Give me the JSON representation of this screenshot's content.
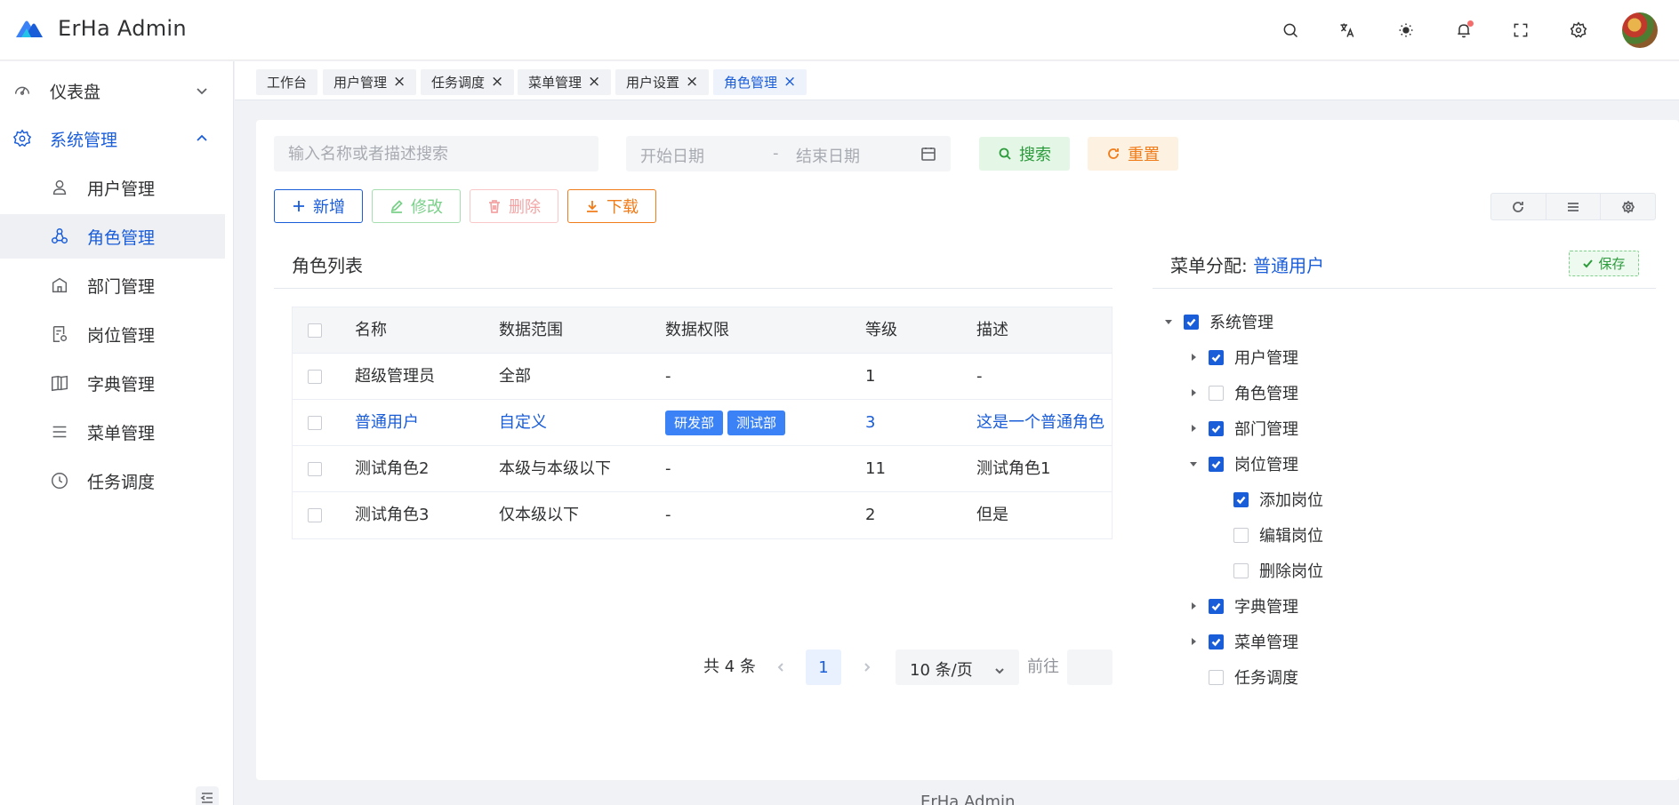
{
  "header": {
    "app_title": "ErHa Admin",
    "icons": [
      "search-icon",
      "translate-icon",
      "theme-sun-icon",
      "bell-icon",
      "fullscreen-icon",
      "settings-icon"
    ],
    "brand_color": "#1a5dd9"
  },
  "sidebar": {
    "items": [
      {
        "label": "仪表盘",
        "icon": "dashboard-icon",
        "arrow": "chevron-down"
      },
      {
        "label": "系统管理",
        "icon": "gear-icon",
        "arrow": "chevron-up",
        "state": "expanded"
      },
      {
        "label": "用户管理",
        "icon": "user-icon"
      },
      {
        "label": "角色管理",
        "icon": "role-icon",
        "state": "active"
      },
      {
        "label": "部门管理",
        "icon": "department-icon"
      },
      {
        "label": "岗位管理",
        "icon": "post-icon"
      },
      {
        "label": "字典管理",
        "icon": "dictionary-icon"
      },
      {
        "label": "菜单管理",
        "icon": "menu-icon"
      },
      {
        "label": "任务调度",
        "icon": "clock-icon"
      }
    ]
  },
  "tabs": [
    {
      "label": "工作台",
      "closable": false
    },
    {
      "label": "用户管理",
      "closable": true
    },
    {
      "label": "任务调度",
      "closable": true
    },
    {
      "label": "菜单管理",
      "closable": true
    },
    {
      "label": "用户设置",
      "closable": true
    },
    {
      "label": "角色管理",
      "closable": true,
      "active": true
    }
  ],
  "filters": {
    "search_placeholder": "输入名称或者描述搜索",
    "date_start_placeholder": "开始日期",
    "date_separator": "-",
    "date_end_placeholder": "结束日期",
    "search_label": "搜索",
    "reset_label": "重置"
  },
  "toolbar": {
    "add_label": "新增",
    "edit_label": "修改",
    "delete_label": "删除",
    "download_label": "下载"
  },
  "role_list": {
    "title": "角色列表",
    "columns": [
      "名称",
      "数据范围",
      "数据权限",
      "等级",
      "描述"
    ],
    "rows": [
      {
        "name": "超级管理员",
        "scope": "全部",
        "permission": "-",
        "tags": [],
        "level": "1",
        "desc": "-"
      },
      {
        "name": "普通用户",
        "scope": "自定义",
        "permission": "",
        "tags": [
          "研发部",
          "测试部"
        ],
        "level": "3",
        "desc": "这是一个普通角色",
        "selected": true
      },
      {
        "name": "测试角色2",
        "scope": "本级与本级以下",
        "permission": "-",
        "tags": [],
        "level": "11",
        "desc": "测试角色1"
      },
      {
        "name": "测试角色3",
        "scope": "仅本级以下",
        "permission": "-",
        "tags": [],
        "level": "2",
        "desc": "但是"
      }
    ]
  },
  "pagination": {
    "total_text": "共 4 条",
    "current_page": "1",
    "page_size": "10 条/页",
    "goto_label": "前往"
  },
  "menu_assign": {
    "title_prefix": "菜单分配:",
    "role_name": "普通用户",
    "save_label": "保存",
    "tree": [
      {
        "label": "系统管理",
        "level": 0,
        "arrow": "down",
        "checked": true
      },
      {
        "label": "用户管理",
        "level": 1,
        "arrow": "right",
        "checked": true
      },
      {
        "label": "角色管理",
        "level": 1,
        "arrow": "right",
        "checked": false
      },
      {
        "label": "部门管理",
        "level": 1,
        "arrow": "right",
        "checked": true
      },
      {
        "label": "岗位管理",
        "level": 1,
        "arrow": "down",
        "checked": true
      },
      {
        "label": "添加岗位",
        "level": 2,
        "arrow": "none",
        "checked": true
      },
      {
        "label": "编辑岗位",
        "level": 2,
        "arrow": "none",
        "checked": false
      },
      {
        "label": "删除岗位",
        "level": 2,
        "arrow": "none",
        "checked": false
      },
      {
        "label": "字典管理",
        "level": 1,
        "arrow": "right",
        "checked": true
      },
      {
        "label": "菜单管理",
        "level": 1,
        "arrow": "right",
        "checked": true
      },
      {
        "label": "任务调度",
        "level": 1,
        "arrow": "none",
        "checked": false
      }
    ]
  },
  "footer": {
    "text": "ErHa Admin"
  }
}
